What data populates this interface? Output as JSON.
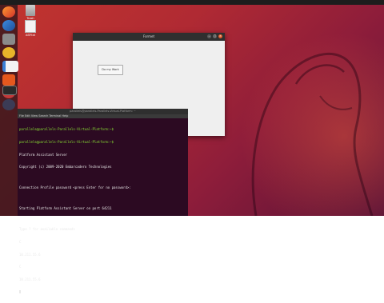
{
  "desktop": {
    "icons": [
      {
        "label": "Trash",
        "icon": "trash-icon"
      },
      {
        "label": "ASP.txt",
        "icon": "text-file-icon"
      }
    ]
  },
  "dock": {
    "items": [
      "firefox-icon",
      "thunderbird-icon",
      "files-icon",
      "rhythmbox-icon",
      "libreoffice-writer-icon",
      "ubuntu-software-icon",
      "help-icon",
      "terminal-icon",
      "app-icon"
    ]
  },
  "window": {
    "title": "Formet",
    "button_label": "Do my Work"
  },
  "terminal": {
    "title": "parallels@parallels-Parallels-Virtual-Platform: ~",
    "menu": "File Edit View Search Terminal Help",
    "lines": [
      {
        "text": "parallels@parallels-Parallels-Virtual-Platform:~$",
        "prompt": true
      },
      {
        "text": "parallels@parallels-Parallels-Virtual-Platform:~$",
        "prompt": true
      },
      {
        "text": "Platform Assistant Server",
        "prompt": false
      },
      {
        "text": "Copyright (c) 2009-2020 Embarcadero Technologies",
        "prompt": false
      },
      {
        "text": "",
        "prompt": false
      },
      {
        "text": "Connection Profile password <press Enter for no password>:",
        "prompt": false
      },
      {
        "text": "",
        "prompt": false
      },
      {
        "text": "Starting Platform Assistant Server on port 64211",
        "prompt": false
      },
      {
        "text": "",
        "prompt": false
      },
      {
        "text": "Type ? for available commands",
        "prompt": false
      },
      {
        "text": "C",
        "prompt": false
      },
      {
        "text": "10.211.55.6",
        "prompt": false
      },
      {
        "text": "C",
        "prompt": false
      },
      {
        "text": "10.211.55.6",
        "prompt": false
      }
    ]
  }
}
